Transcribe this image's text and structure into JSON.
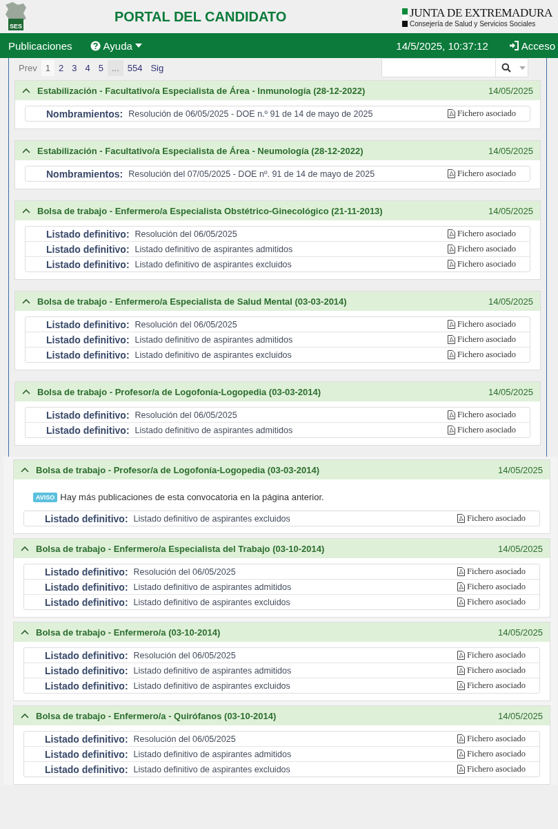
{
  "header": {
    "logo_text": "SES",
    "title": "PORTAL DEL CANDIDATO",
    "org_name": "JUNTA DE EXTREMADURA",
    "org_sub": "Consejería de Salud y Servicios Sociales"
  },
  "nav": {
    "items": [
      {
        "label": "Publicaciones",
        "kind": "link"
      },
      {
        "label": "Ayuda",
        "kind": "dropdown"
      }
    ],
    "datetime": "14/5/2025, 10:37:12",
    "login": "Acceso"
  },
  "pagination": {
    "items": [
      {
        "label": "Prev",
        "selected": false,
        "disabled": true
      },
      {
        "label": "1",
        "selected": true,
        "disabled": false
      },
      {
        "label": "2",
        "selected": false,
        "disabled": false
      },
      {
        "label": "3",
        "selected": false,
        "disabled": false
      },
      {
        "label": "4",
        "selected": false,
        "disabled": false
      },
      {
        "label": "5",
        "selected": false,
        "disabled": false
      },
      {
        "label": "...",
        "kind": "gap",
        "selected": false,
        "disabled": true
      },
      {
        "label": "554",
        "selected": false,
        "disabled": false
      },
      {
        "label": "Sig",
        "selected": false,
        "disabled": false
      }
    ]
  },
  "sections": [
    {
      "publications": [
        {
          "title": "Estabilización - Facultativo/a Especialista de Área - Inmunología (28-12-2022)",
          "date": "14/05/2025",
          "expanded": true,
          "rows": [
            {
              "label": "Nombramientos:",
              "text": "Resolución de 06/05/2025 - DOE n.º 91 de 14 de mayo de 2025",
              "file": "Fichero asociado"
            }
          ]
        },
        {
          "title": "Estabilización - Facultativo/a Especialista de Área - Neumología (28-12-2022)",
          "date": "14/05/2025",
          "expanded": true,
          "rows": [
            {
              "label": "Nombramientos:",
              "text": "Resolución del 07/05/2025 - DOE nº. 91 de 14 de mayo de 2025",
              "file": "Fichero asociado"
            }
          ]
        },
        {
          "title": "Bolsa de trabajo - Enfermero/a Especialista Obstétrico-Ginecológico (21-11-2013)",
          "date": "14/05/2025",
          "expanded": true,
          "rows": [
            {
              "label": "Listado definitivo:",
              "text": "Resolución del 06/05/2025",
              "file": "Fichero asociado"
            },
            {
              "label": "Listado definitivo:",
              "text": "Listado definitivo de aspirantes admitidos",
              "file": "Fichero asociado"
            },
            {
              "label": "Listado definitivo:",
              "text": "Listado definitivo de aspirantes excluidos",
              "file": "Fichero asociado"
            }
          ]
        },
        {
          "title": "Bolsa de trabajo - Enfermero/a Especialista de Salud Mental (03-03-2014)",
          "date": "14/05/2025",
          "expanded": true,
          "rows": [
            {
              "label": "Listado definitivo:",
              "text": "Resolución del 06/05/2025",
              "file": "Fichero asociado"
            },
            {
              "label": "Listado definitivo:",
              "text": "Listado definitivo de aspirantes admitidos",
              "file": "Fichero asociado"
            },
            {
              "label": "Listado definitivo:",
              "text": "Listado definitivo de aspirantes excluidos",
              "file": "Fichero asociado"
            }
          ]
        },
        {
          "title": "Bolsa de trabajo - Profesor/a de Logofonía-Logopedia (03-03-2014)",
          "date": "14/05/2025",
          "expanded": true,
          "rows": [
            {
              "label": "Listado definitivo:",
              "text": "Resolución del 06/05/2025",
              "file": "Fichero asociado"
            },
            {
              "label": "Listado definitivo:",
              "text": "Listado definitivo de aspirantes admitidos",
              "file": "Fichero asociado"
            }
          ]
        }
      ]
    },
    {
      "publications": [
        {
          "title": "Bolsa de trabajo - Profesor/a de Logofonía-Logopedia (03-03-2014)",
          "date": "14/05/2025",
          "expanded": true,
          "notice": {
            "badge": "AVISO",
            "text": "Hay más publicaciones de esta convocatoria en la página anterior."
          },
          "rows": [
            {
              "label": "Listado definitivo:",
              "text": "Listado definitivo de aspirantes excluidos",
              "file": "Fichero asociado"
            }
          ]
        },
        {
          "title": "Bolsa de trabajo - Enfermero/a Especialista del Trabajo (03-10-2014)",
          "date": "14/05/2025",
          "expanded": true,
          "rows": [
            {
              "label": "Listado definitivo:",
              "text": "Resolución del 06/05/2025",
              "file": "Fichero asociado"
            },
            {
              "label": "Listado definitivo:",
              "text": "Listado definitivo de aspirantes admitidos",
              "file": "Fichero asociado"
            },
            {
              "label": "Listado definitivo:",
              "text": "Listado definitivo de aspirantes excluidos",
              "file": "Fichero asociado"
            }
          ]
        },
        {
          "title": "Bolsa de trabajo - Enfermero/a (03-10-2014)",
          "date": "14/05/2025",
          "expanded": true,
          "rows": [
            {
              "label": "Listado definitivo:",
              "text": "Resolución del 06/05/2025",
              "file": "Fichero asociado"
            },
            {
              "label": "Listado definitivo:",
              "text": "Listado definitivo de aspirantes admitidos",
              "file": "Fichero asociado"
            },
            {
              "label": "Listado definitivo:",
              "text": "Listado definitivo de aspirantes excluidos",
              "file": "Fichero asociado"
            }
          ]
        },
        {
          "title": "Bolsa de trabajo - Enfermero/a - Quirófanos (03-10-2014)",
          "date": "14/05/2025",
          "expanded": true,
          "rows": [
            {
              "label": "Listado definitivo:",
              "text": "Resolución del 06/05/2025",
              "file": "Fichero asociado"
            },
            {
              "label": "Listado definitivo:",
              "text": "Listado definitivo de aspirantes admitidos",
              "file": "Fichero asociado"
            },
            {
              "label": "Listado definitivo:",
              "text": "Listado definitivo de aspirantes excluidos",
              "file": "Fichero asociado"
            }
          ]
        }
      ]
    }
  ]
}
